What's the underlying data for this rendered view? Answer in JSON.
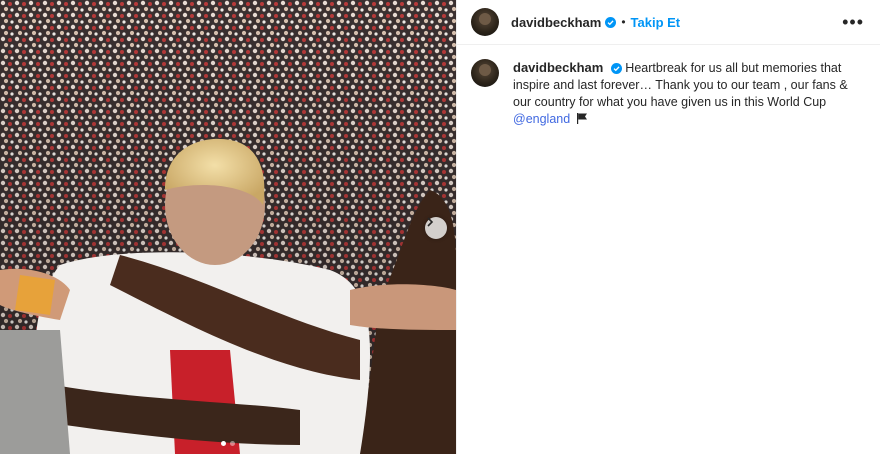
{
  "post": {
    "username": "davidbeckham",
    "follow_label": "Takip Et",
    "separator": "•",
    "more_label": "•••",
    "caption_text": "Heartbreak for us all but memories that inspire and last forever… Thank you to our team , our fans & our country for what you have given us in this World Cup",
    "mention": "@england",
    "flag_icon": "black-flag-icon"
  },
  "carousel": {
    "current": 1,
    "total": 2
  },
  "colors": {
    "follow": "#0095f6",
    "verified": "#0095f6",
    "mention": "#4169e1"
  }
}
